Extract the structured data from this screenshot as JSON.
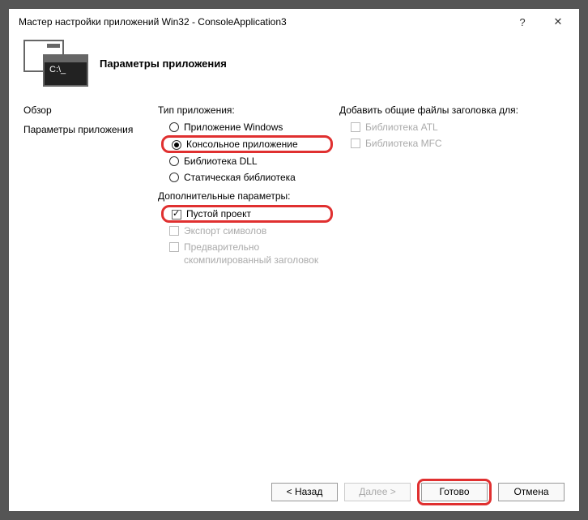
{
  "titlebar": {
    "title": "Мастер настройки приложений Win32 - ConsoleApplication3"
  },
  "header": {
    "heading": "Параметры приложения",
    "icon_prompt": "C:\\_"
  },
  "sidebar": {
    "items": [
      {
        "label": "Обзор"
      },
      {
        "label": "Параметры приложения"
      }
    ]
  },
  "content": {
    "app_type": {
      "label": "Тип приложения:",
      "options": [
        {
          "label": "Приложение Windows",
          "checked": false
        },
        {
          "label": "Консольное приложение",
          "checked": true,
          "highlight": true
        },
        {
          "label": "Библиотека DLL",
          "checked": false
        },
        {
          "label": "Статическая библиотека",
          "checked": false
        }
      ]
    },
    "extra": {
      "label": "Дополнительные параметры:",
      "options": [
        {
          "label": "Пустой проект",
          "checked": true,
          "highlight": true,
          "enabled": true
        },
        {
          "label": "Экспорт символов",
          "checked": false,
          "enabled": false
        },
        {
          "label": "Предварительно скомпилированный заголовок",
          "checked": false,
          "enabled": false
        }
      ]
    },
    "headers": {
      "label": "Добавить общие файлы заголовка для:",
      "options": [
        {
          "label": "Библиотека ATL",
          "checked": false,
          "enabled": false
        },
        {
          "label": "Библиотека MFC",
          "checked": false,
          "enabled": false
        }
      ]
    }
  },
  "footer": {
    "back": "< Назад",
    "next": "Далее >",
    "finish": "Готово",
    "cancel": "Отмена"
  }
}
